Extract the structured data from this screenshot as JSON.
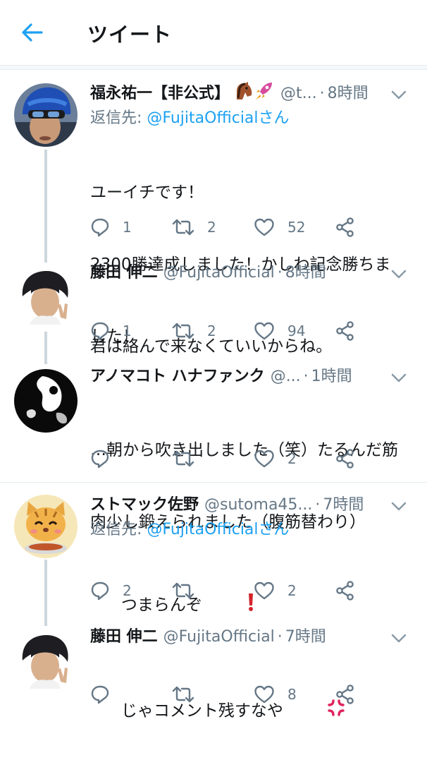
{
  "header": {
    "title": "ツイート",
    "back_icon": "arrow-left-icon",
    "accent": "#1da1f2"
  },
  "tweets": [
    {
      "name": "福永祐一【非公式】",
      "name_emoji": [
        "horse-face-emoji",
        "rocket-emoji"
      ],
      "handle": "@t...",
      "dot": "·",
      "time": "8時間",
      "reply_prefix": "返信先: ",
      "reply_to": "@FujitaOfficialさん",
      "lines": [
        "ユーイチです！",
        "2300勝達成しました！かしわ記念勝ちま",
        "した！"
      ],
      "replies": "1",
      "retweets": "2",
      "likes": "52"
    },
    {
      "name": "藤田 伸二",
      "handle": "@FujitaOfficial",
      "dot": "·",
      "time": "8時間",
      "lines": [
        "君は絡んで来なくていいからね。"
      ],
      "replies": "1",
      "retweets": "2",
      "likes": "94"
    },
    {
      "name": "アノマコト ハナファンク",
      "handle": "@...",
      "dot": "·",
      "time": "1時間",
      "lines": [
        "…朝から吹き出しました（笑）たるんだ筋",
        "肉少し鍛えられました（腹筋替わり）"
      ],
      "replies": "",
      "retweets": "",
      "likes": "2"
    },
    {
      "name": "ストマック佐野",
      "handle": "@sutoma45...",
      "dot": "·",
      "time": "7時間",
      "reply_prefix": "返信先: ",
      "reply_to": "@FujitaOfficialさん",
      "lines": [
        "つまらんぞ"
      ],
      "body_emoji": "red-exclamation-emoji",
      "replies": "2",
      "retweets": "",
      "likes": "2"
    },
    {
      "name": "藤田 伸二",
      "handle": "@FujitaOfficial",
      "dot": "·",
      "time": "7時間",
      "lines": [
        "じゃコメント残すなや"
      ],
      "body_emoji": "anger-symbol-emoji",
      "replies": "",
      "retweets": "",
      "likes": "8"
    }
  ]
}
